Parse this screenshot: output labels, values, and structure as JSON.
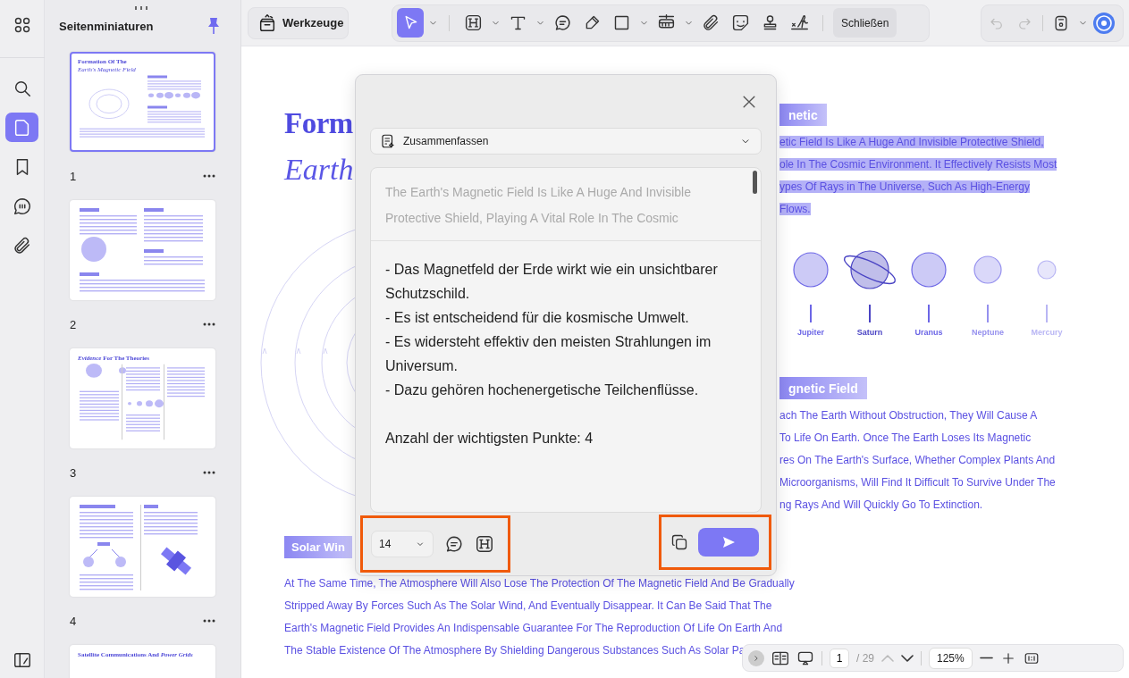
{
  "rail": {
    "items": [
      {
        "kind": "search",
        "selected": false
      },
      {
        "kind": "pages",
        "selected": true
      },
      {
        "kind": "bookmarks",
        "selected": false
      },
      {
        "kind": "comments",
        "selected": false
      },
      {
        "kind": "attachments",
        "selected": false
      }
    ]
  },
  "thumbnail_panel": {
    "title": "Seitenminiaturen",
    "pages": [
      {
        "number": "1",
        "selected": true,
        "title": "Formation Of The",
        "subtitle": "Earth's Magnetic Field"
      },
      {
        "number": "2",
        "selected": false
      },
      {
        "number": "3",
        "selected": false,
        "title": "*Evidence* For The Theories"
      },
      {
        "number": "4",
        "selected": false
      },
      {
        "title": "Satellite Communications And *Power Grids*"
      }
    ]
  },
  "toolbar": {
    "tools_button": "Werkzeuge",
    "tools": [
      {
        "kind": "select",
        "selected": true,
        "menu": true
      },
      {
        "kind": "heading",
        "selected": false,
        "menu": true
      },
      {
        "kind": "text",
        "selected": false,
        "menu": true
      },
      {
        "kind": "comment",
        "selected": false,
        "menu": false
      },
      {
        "kind": "pencil",
        "selected": false,
        "menu": false
      },
      {
        "kind": "shape",
        "selected": false,
        "menu": true
      },
      {
        "kind": "measure",
        "selected": false,
        "menu": true
      },
      {
        "kind": "attach",
        "selected": false,
        "menu": false
      },
      {
        "kind": "sticker",
        "selected": false,
        "menu": false
      },
      {
        "kind": "stamp",
        "selected": false,
        "menu": false
      },
      {
        "kind": "signature",
        "selected": false,
        "menu": false
      }
    ],
    "close_button": "Schließen",
    "history": [
      {
        "kind": "undo",
        "disabled": true
      },
      {
        "kind": "redo",
        "disabled": true
      }
    ]
  },
  "document": {
    "title": "Form",
    "subtitle": "Earth",
    "section_1": {
      "heading": "netic",
      "highlighted": true,
      "lines": [
        "etic Field Is Like A Huge And Invisible Protective Shield,",
        "ole In The Cosmic Environment. It Effectively Resists Most",
        "ypes Of Rays in The Universe, Such As High-Energy",
        "Flows."
      ]
    },
    "planets": [
      {
        "name": "Jupiter",
        "color": "#6c66e6",
        "ringed": false
      },
      {
        "name": "Saturn",
        "color": "#4a44c4",
        "ringed": true
      },
      {
        "name": "Uranus",
        "color": "#6c66e6",
        "ringed": false
      },
      {
        "name": "Neptune",
        "color": "#9590ee",
        "ringed": false
      },
      {
        "name": "Mercury",
        "color": "#b9b6f4",
        "ringed": false
      }
    ],
    "section_2": {
      "heading": "gnetic Field",
      "highlighted": false,
      "lines": [
        "ach The Earth Without Obstruction, They Will Cause A",
        "To Life On Earth. Once The Earth Loses Its Magnetic",
        "res On The Earth's Surface, Whether Complex Plants And",
        "Microorganisms, Will Find It Difficult To Survive Under The",
        "ng Rays And Will Quickly Go To Extinction."
      ]
    },
    "section_3": {
      "heading": "Solar Win",
      "highlighted": false,
      "lines": [
        "At The Same Time, The Atmosphere Will Also Lose The Protection Of The Magnetic Field And Be Gradually",
        "Stripped Away By Forces Such As The Solar Wind, And Eventually Disappear. It Can Be Said That The",
        "Earth's Magnetic Field Provides An Indispensable Guarantee For The Reproduction Of Life On Earth And",
        "The Stable Existence Of The Atmosphere By Shielding Dangerous Substances Such As Solar Pa"
      ]
    }
  },
  "dialog": {
    "mode": "Zusammenfassen",
    "source_text": "The Earth's Magnetic Field Is Like A Huge And Invisible Protective Shield, Playing A Vital Role In The Cosmic",
    "result_lines": [
      "- Das Magnetfeld der Erde wirkt wie ein unsichtbarer Schutzschild.",
      "- Es ist entscheidend für die kosmische Umwelt.",
      "- Es widersteht effektiv den meisten Strahlungen im Universum.",
      "- Dazu gehören hochenergetische Teilchenflüsse."
    ],
    "summary_count": "Anzahl der wichtigsten Punkte: 4",
    "font_size": "14"
  },
  "bottom_bar": {
    "page": "1",
    "page_total": "/ 29",
    "zoom": "125%"
  }
}
